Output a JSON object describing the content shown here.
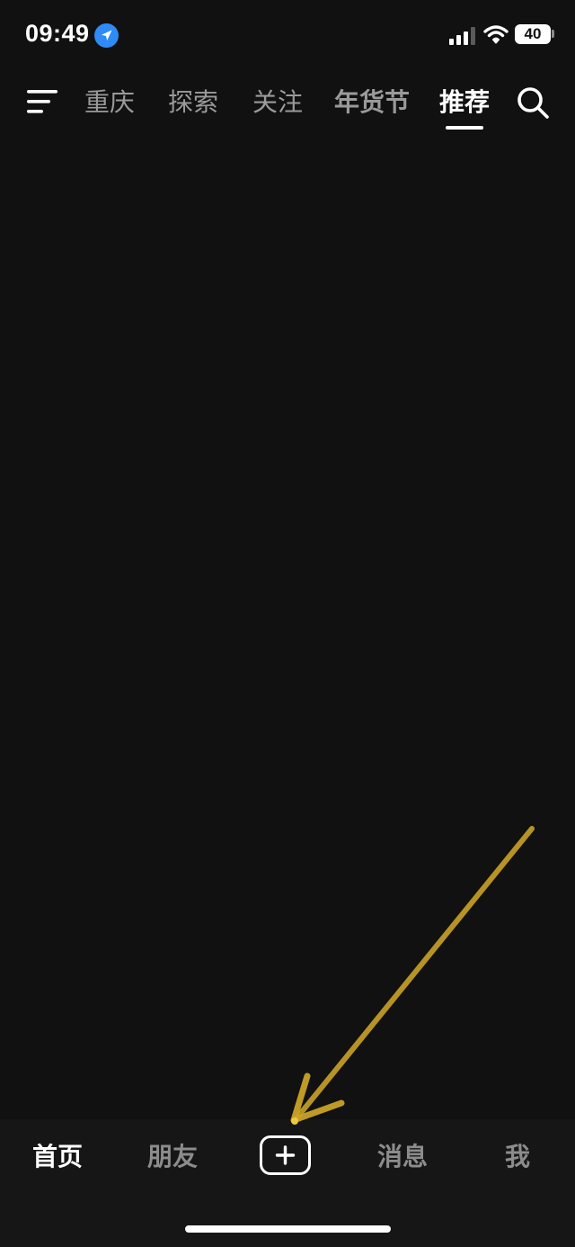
{
  "status_bar": {
    "time": "09:49",
    "battery": "40",
    "icons": [
      "location-arrow-icon",
      "cellular-signal-icon",
      "wifi-icon",
      "battery-icon"
    ]
  },
  "top_nav": {
    "menu_icon": "hamburger-menu-icon",
    "tabs": [
      {
        "label": "重庆"
      },
      {
        "label": "探索"
      },
      {
        "label": "关注"
      },
      {
        "label": "年货节"
      },
      {
        "label": "推荐"
      }
    ],
    "active_tab": "推荐",
    "search_icon": "search-icon"
  },
  "bottom_nav": {
    "tabs": [
      {
        "label": "首页"
      },
      {
        "label": "朋友"
      },
      {
        "label": "消息"
      },
      {
        "label": "我"
      }
    ],
    "active_tab": "首页",
    "create_icon": "plus-icon"
  },
  "colors": {
    "background": "#111112",
    "bottom_bar": "#161617",
    "active_text": "#ffffff",
    "inactive_text": "#9a9a9a",
    "location_accent": "#2f8cf6",
    "annotation_arrow": "#c9a227"
  }
}
